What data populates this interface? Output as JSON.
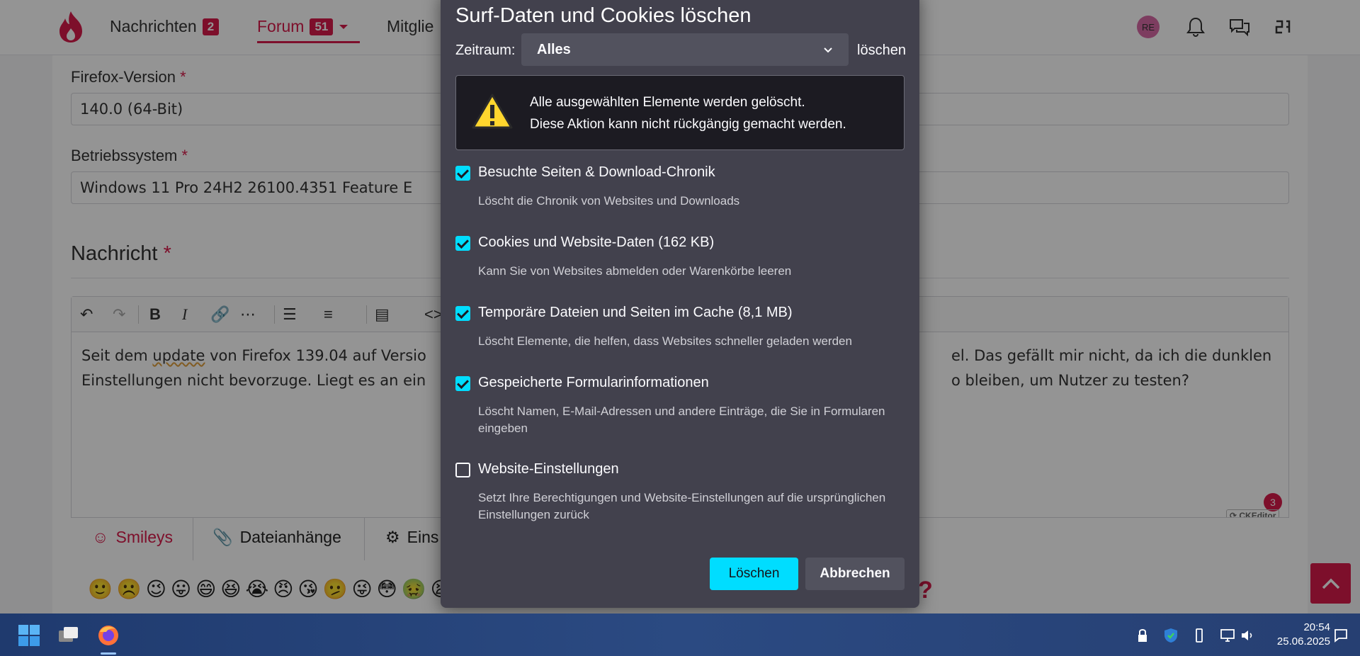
{
  "nav": {
    "items": [
      {
        "label": "Nachrichten",
        "badge": "2"
      },
      {
        "label": "Forum",
        "badge": "51"
      },
      {
        "label": "Mitglie"
      }
    ],
    "avatar_initials": "RE"
  },
  "form": {
    "firefox_version_label": "Firefox-Version",
    "firefox_version_value": "140.0 (64-Bit)",
    "os_label": "Betriebssystem",
    "os_value": "Windows 11 Pro  24H2  26100.4351  Feature E",
    "required_mark": "*",
    "message_title": "Nachricht",
    "editor_line1_a": "Seit dem ",
    "editor_line1_b": "update",
    "editor_line1_c": " von Firefox 139.04 auf Versio",
    "editor_line1_d": "el. Das gefällt mir nicht, da ich die dunklen",
    "editor_line2_a": "Einstellungen nicht bevorzuge. Liegt es an ein",
    "editor_line2_b": "o bleiben, um Nutzer zu testen?",
    "ck_count": "3",
    "ck_label": "CKEditor"
  },
  "tabs": [
    {
      "label": "Smileys"
    },
    {
      "label": "Dateianhänge"
    },
    {
      "label": "Eins"
    }
  ],
  "emojis": "🙂☹️😉😛😄😆😭😠😘🫤😜😳🤢😫",
  "dialog": {
    "title": "Surf-Daten und Cookies löschen",
    "range_label": "Zeitraum:",
    "range_value": "Alles",
    "range_suffix": "löschen",
    "warning_line1": "Alle ausgewählten Elemente werden gelöscht.",
    "warning_line2": "Diese Aktion kann nicht rückgängig gemacht werden.",
    "options": [
      {
        "label": "Besuchte Seiten & Download-Chronik",
        "desc": "Löscht die Chronik von Websites und Downloads",
        "checked": true
      },
      {
        "label": "Cookies und Website-Daten (162 KB)",
        "desc": "Kann Sie von Websites abmelden oder Warenkörbe leeren",
        "checked": true
      },
      {
        "label": "Temporäre Dateien und Seiten im Cache (8,1 MB)",
        "desc": "Löscht Elemente, die helfen, dass Websites schneller geladen werden",
        "checked": true
      },
      {
        "label": "Gespeicherte Formularinformationen",
        "desc": "Löscht Namen, E-Mail-Adressen und andere Einträge, die Sie in Formularen eingeben",
        "checked": true
      },
      {
        "label": "Website-Einstellungen",
        "desc": "Setzt Ihre Berechtigungen und Website-Einstellungen auf die ursprünglichen Einstellungen zurück",
        "checked": false
      }
    ],
    "primary_button": "Löschen",
    "secondary_button": "Abbrechen"
  },
  "taskbar": {
    "time": "20:54",
    "date": "25.06.2025"
  },
  "colors": {
    "brand": "#d81b4a",
    "accent": "#00ddff",
    "dialog_bg": "#42414d"
  }
}
